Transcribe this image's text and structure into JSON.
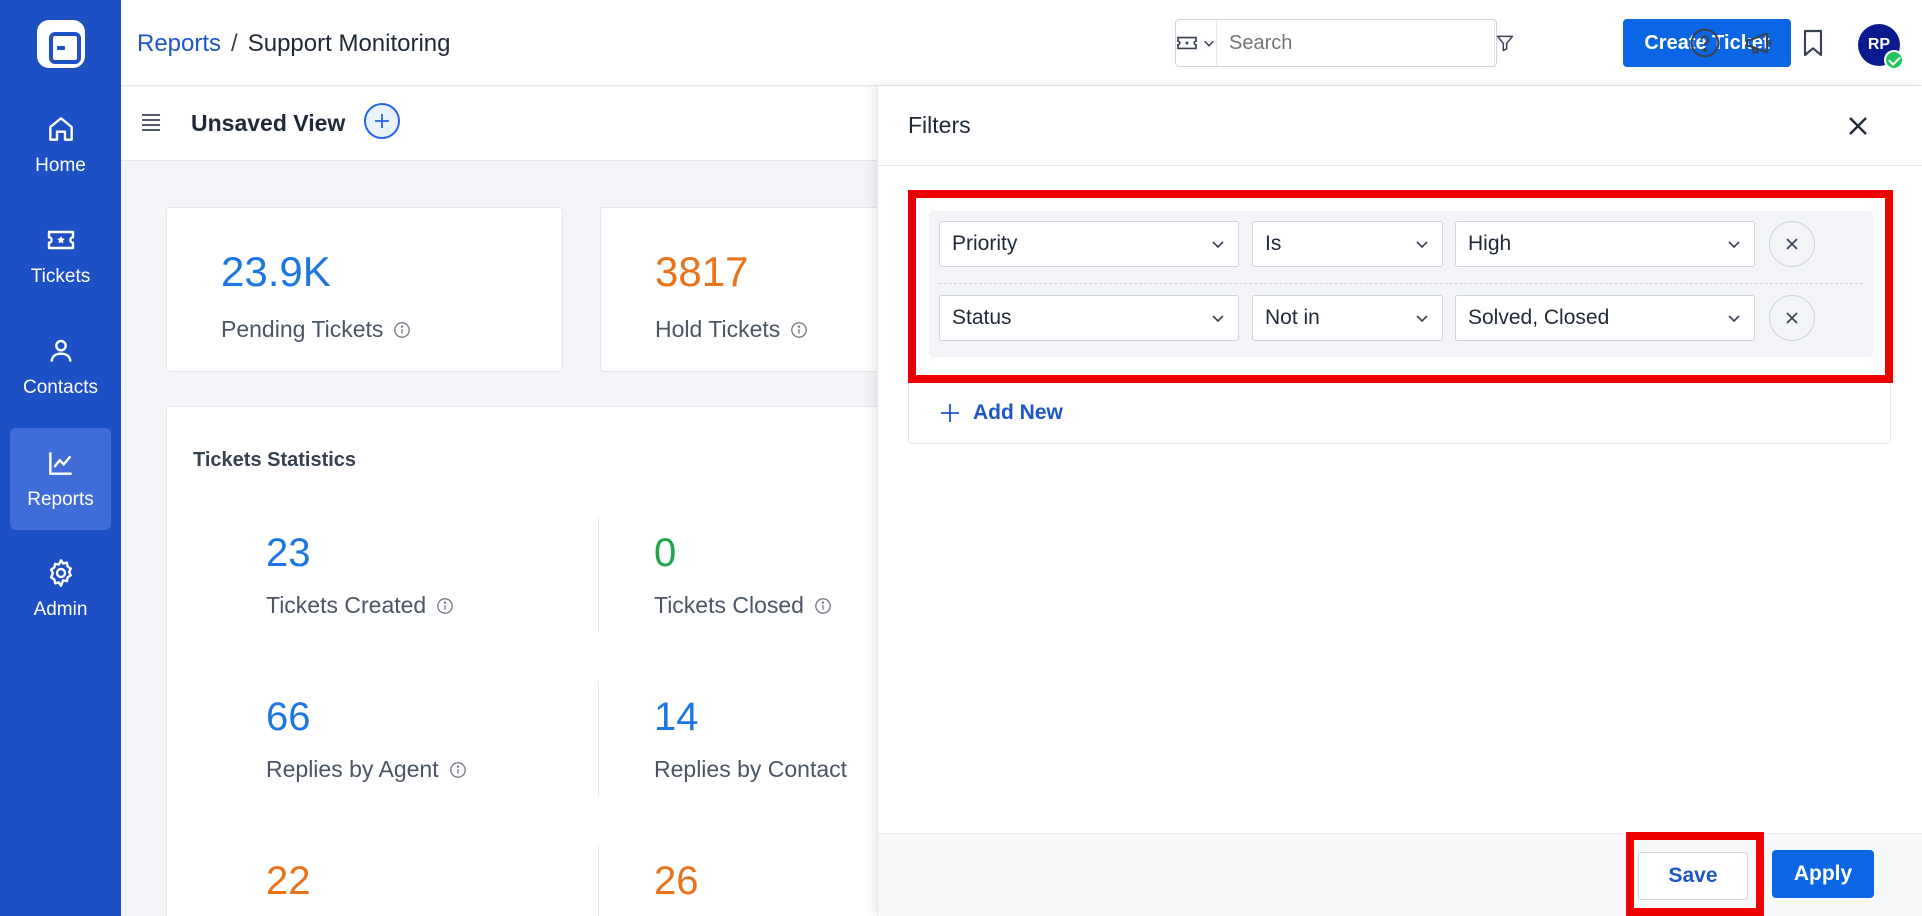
{
  "sidebar": {
    "items": [
      {
        "label": "Home",
        "icon": "home-icon"
      },
      {
        "label": "Tickets",
        "icon": "ticket-icon"
      },
      {
        "label": "Contacts",
        "icon": "user-icon"
      },
      {
        "label": "Reports",
        "icon": "chart-icon",
        "active": true
      },
      {
        "label": "Admin",
        "icon": "gear-icon"
      }
    ]
  },
  "header": {
    "breadcrumb_link": "Reports",
    "breadcrumb_sep": "/",
    "breadcrumb_current": "Support Monitoring",
    "search_placeholder": "Search",
    "create_button": "Create Ticket",
    "avatar_initials": "RP"
  },
  "subheader": {
    "view_title": "Unsaved View"
  },
  "kpis": [
    {
      "value": "23.9K",
      "label": "Pending Tickets",
      "color": "#1e77e1"
    },
    {
      "value": "3817",
      "label": "Hold Tickets",
      "color": "#e8731a"
    }
  ],
  "stats": {
    "title": "Tickets Statistics",
    "items": [
      {
        "value": "23",
        "label": "Tickets Created",
        "color": "#1e77e1"
      },
      {
        "value": "0",
        "label": "Tickets Closed",
        "color": "#1ea64b"
      },
      {
        "value": "66",
        "label": "Replies by Agent",
        "color": "#1e77e1"
      },
      {
        "value": "14",
        "label": "Replies by Contact",
        "color": "#1e77e1"
      },
      {
        "value": "22",
        "label": "",
        "color": "#e8731a"
      },
      {
        "value": "26",
        "label": "",
        "color": "#e8731a"
      }
    ]
  },
  "filters": {
    "title": "Filters",
    "rows": [
      {
        "field": "Priority",
        "operator": "Is",
        "value": "High"
      },
      {
        "field": "Status",
        "operator": "Not in",
        "value": "Solved, Closed"
      }
    ],
    "add_new": "Add New",
    "save": "Save",
    "apply": "Apply"
  },
  "colors": {
    "sidebar": "#1e50c5",
    "primary": "#0a66e4",
    "highlight": "#ee0000"
  }
}
